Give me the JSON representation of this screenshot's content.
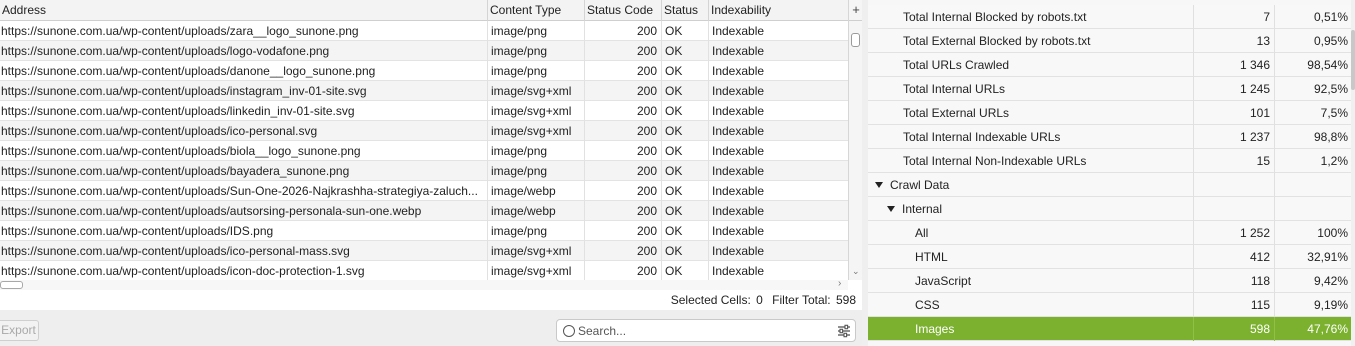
{
  "table": {
    "columns": [
      "Address",
      "Content Type",
      "Status Code",
      "Status",
      "Indexability"
    ],
    "rows": [
      {
        "address": "https://sunone.com.ua/wp-content/uploads/zara__logo_sunone.png",
        "content_type": "image/png",
        "status_code": "200",
        "status": "OK",
        "indexability": "Indexable"
      },
      {
        "address": "https://sunone.com.ua/wp-content/uploads/logo-vodafone.png",
        "content_type": "image/png",
        "status_code": "200",
        "status": "OK",
        "indexability": "Indexable"
      },
      {
        "address": "https://sunone.com.ua/wp-content/uploads/danone__logo_sunone.png",
        "content_type": "image/png",
        "status_code": "200",
        "status": "OK",
        "indexability": "Indexable"
      },
      {
        "address": "https://sunone.com.ua/wp-content/uploads/instagram_inv-01-site.svg",
        "content_type": "image/svg+xml",
        "status_code": "200",
        "status": "OK",
        "indexability": "Indexable"
      },
      {
        "address": "https://sunone.com.ua/wp-content/uploads/linkedin_inv-01-site.svg",
        "content_type": "image/svg+xml",
        "status_code": "200",
        "status": "OK",
        "indexability": "Indexable"
      },
      {
        "address": "https://sunone.com.ua/wp-content/uploads/ico-personal.svg",
        "content_type": "image/svg+xml",
        "status_code": "200",
        "status": "OK",
        "indexability": "Indexable"
      },
      {
        "address": "https://sunone.com.ua/wp-content/uploads/biola__logo_sunone.png",
        "content_type": "image/png",
        "status_code": "200",
        "status": "OK",
        "indexability": "Indexable"
      },
      {
        "address": "https://sunone.com.ua/wp-content/uploads/bayadera_sunone.png",
        "content_type": "image/png",
        "status_code": "200",
        "status": "OK",
        "indexability": "Indexable"
      },
      {
        "address": "https://sunone.com.ua/wp-content/uploads/Sun-One-2026-Najkrashha-strategiya-zaluch...",
        "content_type": "image/webp",
        "status_code": "200",
        "status": "OK",
        "indexability": "Indexable"
      },
      {
        "address": "https://sunone.com.ua/wp-content/uploads/autsorsing-personala-sun-one.webp",
        "content_type": "image/webp",
        "status_code": "200",
        "status": "OK",
        "indexability": "Indexable"
      },
      {
        "address": "https://sunone.com.ua/wp-content/uploads/IDS.png",
        "content_type": "image/png",
        "status_code": "200",
        "status": "OK",
        "indexability": "Indexable"
      },
      {
        "address": "https://sunone.com.ua/wp-content/uploads/ico-personal-mass.svg",
        "content_type": "image/svg+xml",
        "status_code": "200",
        "status": "OK",
        "indexability": "Indexable"
      },
      {
        "address": "https://sunone.com.ua/wp-content/uploads/icon-doc-protection-1.svg",
        "content_type": "image/svg+xml",
        "status_code": "200",
        "status": "OK",
        "indexability": "Indexable"
      }
    ]
  },
  "add_column_label": "+",
  "status_bar": {
    "selected_cells_label": "Selected Cells:",
    "selected_cells_value": "0",
    "filter_total_label": "Filter Total:",
    "filter_total_value": "598"
  },
  "export_label": "Export",
  "search": {
    "placeholder": "Search..."
  },
  "overview": {
    "rows": [
      {
        "label": "Total Internal Blocked by robots.txt",
        "value": "7",
        "pct": "0,51%",
        "level": 1
      },
      {
        "label": "Total External Blocked by robots.txt",
        "value": "13",
        "pct": "0,95%",
        "level": 1
      },
      {
        "label": "Total URLs Crawled",
        "value": "1 346",
        "pct": "98,54%",
        "level": 1
      },
      {
        "label": "Total Internal URLs",
        "value": "1 245",
        "pct": "92,5%",
        "level": 1
      },
      {
        "label": "Total External URLs",
        "value": "101",
        "pct": "7,5%",
        "level": 1
      },
      {
        "label": "Total Internal Indexable URLs",
        "value": "1 237",
        "pct": "98,8%",
        "level": 1
      },
      {
        "label": "Total Internal Non-Indexable URLs",
        "value": "15",
        "pct": "1,2%",
        "level": 1
      },
      {
        "label": "Crawl Data",
        "value": "",
        "pct": "",
        "level": 0,
        "expanded": true
      },
      {
        "label": "Internal",
        "value": "",
        "pct": "",
        "level": 1,
        "expanded": true
      },
      {
        "label": "All",
        "value": "1 252",
        "pct": "100%",
        "level": 2
      },
      {
        "label": "HTML",
        "value": "412",
        "pct": "32,91%",
        "level": 2
      },
      {
        "label": "JavaScript",
        "value": "118",
        "pct": "9,42%",
        "level": 2
      },
      {
        "label": "CSS",
        "value": "115",
        "pct": "9,19%",
        "level": 2
      },
      {
        "label": "Images",
        "value": "598",
        "pct": "47,76%",
        "level": 2,
        "selected": true
      }
    ]
  },
  "colors": {
    "selected_row": "#7bb12f",
    "header_bg": "#f3f3f3",
    "alt_row_bg": "#f4f4f4"
  },
  "icons": [
    "add-column-icon",
    "search-icon",
    "filter-settings-icon",
    "expand-triangle-icon"
  ]
}
